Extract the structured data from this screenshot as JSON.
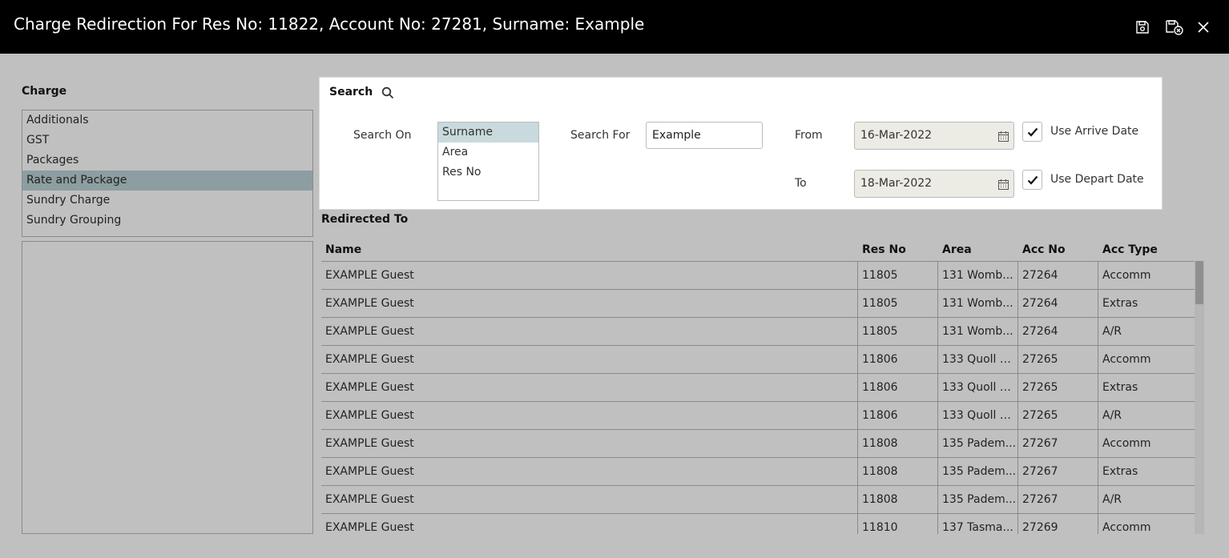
{
  "window": {
    "title": "Charge Redirection For Res No: 11822, Account No: 27281, Surname: Example",
    "buttons": [
      "save-icon",
      "save-close-icon",
      "close-icon"
    ]
  },
  "charge": {
    "label": "Charge",
    "items": [
      "Additionals",
      "GST",
      "Packages",
      "Rate and Package",
      "Sundry Charge",
      "Sundry Grouping"
    ],
    "selected": "Rate and Package"
  },
  "search": {
    "label": "Search",
    "search_on_label": "Search On",
    "search_on_options": [
      "Surname",
      "Area",
      "Res No"
    ],
    "search_on_selected": "Surname",
    "search_for_label": "Search For",
    "search_for_value": "Example",
    "from_label": "From",
    "from_value": "16-Mar-2022",
    "to_label": "To",
    "to_value": "18-Mar-2022",
    "use_arrive_label": "Use Arrive Date",
    "use_arrive_checked": true,
    "use_depart_label": "Use Depart Date",
    "use_depart_checked": true
  },
  "redirected": {
    "label": "Redirected To",
    "columns": [
      "Name",
      "Res No",
      "Area",
      "Acc No",
      "Acc Type"
    ],
    "rows": [
      [
        "EXAMPLE Guest",
        "11805",
        "131 Womb...",
        "27264",
        "Accomm"
      ],
      [
        "EXAMPLE Guest",
        "11805",
        "131 Womb...",
        "27264",
        "Extras"
      ],
      [
        "EXAMPLE Guest",
        "11805",
        "131 Womb...",
        "27264",
        "A/R"
      ],
      [
        "EXAMPLE Guest",
        "11806",
        "133 Quoll C...",
        "27265",
        "Accomm"
      ],
      [
        "EXAMPLE Guest",
        "11806",
        "133 Quoll C...",
        "27265",
        "Extras"
      ],
      [
        "EXAMPLE Guest",
        "11806",
        "133 Quoll C...",
        "27265",
        "A/R"
      ],
      [
        "EXAMPLE Guest",
        "11808",
        "135 Padem...",
        "27267",
        "Accomm"
      ],
      [
        "EXAMPLE Guest",
        "11808",
        "135 Padem...",
        "27267",
        "Extras"
      ],
      [
        "EXAMPLE Guest",
        "11808",
        "135 Padem...",
        "27267",
        "A/R"
      ],
      [
        "EXAMPLE Guest",
        "11810",
        "137 Tasma...",
        "27269",
        "Accomm"
      ]
    ]
  }
}
